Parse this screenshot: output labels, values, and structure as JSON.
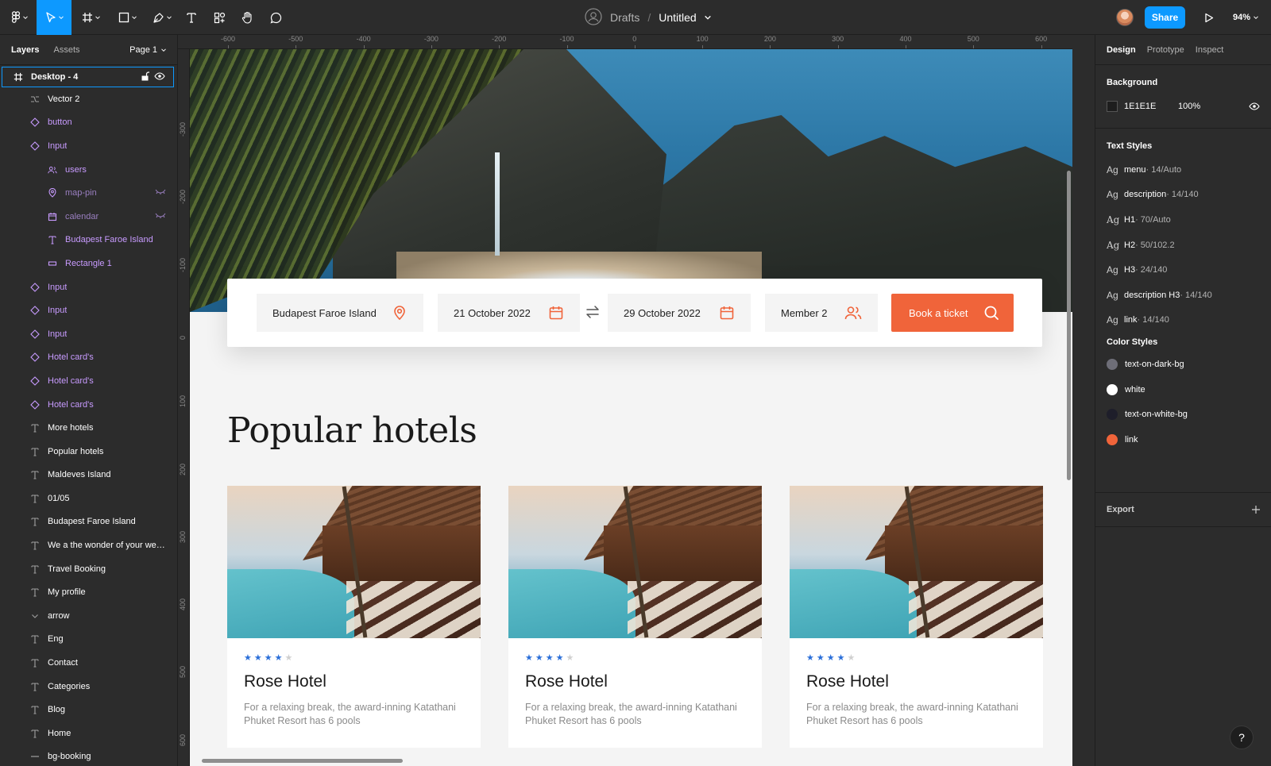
{
  "toolbar": {
    "breadcrumb_folder": "Drafts",
    "breadcrumb_separator": "/",
    "file_name": "Untitled",
    "share_label": "Share",
    "zoom_level": "94%"
  },
  "left_panel": {
    "tabs": [
      "Layers",
      "Assets"
    ],
    "page": "Page 1",
    "selected_layer": "Desktop - 4",
    "layers": [
      {
        "name": "Vector 2",
        "icon": "vector-icon",
        "kind": "plain",
        "level": "top"
      },
      {
        "name": "button",
        "icon": "component-icon",
        "kind": "comp",
        "level": "top"
      },
      {
        "name": "Input",
        "icon": "component-icon",
        "kind": "comp",
        "level": "top"
      },
      {
        "name": "users",
        "icon": "users-icon",
        "kind": "comp",
        "level": "child"
      },
      {
        "name": "map-pin",
        "icon": "map-pin-icon",
        "kind": "comp-hidden",
        "level": "child"
      },
      {
        "name": "calendar",
        "icon": "calendar-icon",
        "kind": "comp-hidden",
        "level": "child"
      },
      {
        "name": "Budapest Faroe Island",
        "icon": "text-icon",
        "kind": "comp",
        "level": "child"
      },
      {
        "name": "Rectangle 1",
        "icon": "rectangle-icon",
        "kind": "comp",
        "level": "child"
      },
      {
        "name": "Input",
        "icon": "component-icon",
        "kind": "comp",
        "level": "top"
      },
      {
        "name": "Input",
        "icon": "component-icon",
        "kind": "comp",
        "level": "top"
      },
      {
        "name": "Input",
        "icon": "component-icon",
        "kind": "comp",
        "level": "top"
      },
      {
        "name": "Hotel card's",
        "icon": "component-icon",
        "kind": "comp",
        "level": "top"
      },
      {
        "name": "Hotel card's",
        "icon": "component-icon",
        "kind": "comp",
        "level": "top"
      },
      {
        "name": "Hotel card's",
        "icon": "component-icon",
        "kind": "comp",
        "level": "top"
      },
      {
        "name": "More hotels",
        "icon": "text-icon",
        "kind": "plain",
        "level": "top"
      },
      {
        "name": "Popular hotels",
        "icon": "text-icon",
        "kind": "plain",
        "level": "top"
      },
      {
        "name": "Maldeves Island",
        "icon": "text-icon",
        "kind": "plain",
        "level": "top"
      },
      {
        "name": "01/05",
        "icon": "text-icon",
        "kind": "plain",
        "level": "top"
      },
      {
        "name": "Budapest Faroe Island",
        "icon": "text-icon",
        "kind": "plain",
        "level": "top"
      },
      {
        "name": "We a the wonder of your week...",
        "icon": "text-icon",
        "kind": "plain",
        "level": "top"
      },
      {
        "name": "Travel Booking",
        "icon": "text-icon",
        "kind": "plain",
        "level": "top"
      },
      {
        "name": "My profile",
        "icon": "text-icon",
        "kind": "plain",
        "level": "top"
      },
      {
        "name": "arrow",
        "icon": "chevron-down-icon",
        "kind": "plain",
        "level": "top"
      },
      {
        "name": "Eng",
        "icon": "text-icon",
        "kind": "plain",
        "level": "top"
      },
      {
        "name": "Contact",
        "icon": "text-icon",
        "kind": "plain",
        "level": "top"
      },
      {
        "name": "Categories",
        "icon": "text-icon",
        "kind": "plain",
        "level": "top"
      },
      {
        "name": "Blog",
        "icon": "text-icon",
        "kind": "plain",
        "level": "top"
      },
      {
        "name": "Home",
        "icon": "text-icon",
        "kind": "plain",
        "level": "top"
      },
      {
        "name": "bg-booking",
        "icon": "line-icon",
        "kind": "plain",
        "level": "top"
      }
    ]
  },
  "rulers": {
    "top": [
      "-600",
      "-500",
      "-400",
      "-300",
      "-200",
      "-100",
      "0",
      "100",
      "200",
      "300",
      "400",
      "500",
      "600"
    ],
    "left": [
      "-300",
      "-200",
      "-100",
      "0",
      "100",
      "200",
      "300",
      "400",
      "500",
      "600"
    ]
  },
  "canvas": {
    "search": {
      "location": "Budapest Faroe Island",
      "check_in": "21 October 2022",
      "check_out": "29 October 2022",
      "members": "Member 2",
      "book_label": "Book a ticket"
    },
    "section_title": "Popular hotels",
    "hotels": [
      {
        "name": "Rose Hotel",
        "rating": 4,
        "max_rating": 5,
        "description": "For a relaxing break, the award-inning Katathani Phuket Resort has 6 pools"
      },
      {
        "name": "Rose Hotel",
        "rating": 4,
        "max_rating": 5,
        "description": "For a relaxing break, the award-inning Katathani Phuket Resort has 6 pools"
      },
      {
        "name": "Rose Hotel",
        "rating": 4,
        "max_rating": 5,
        "description": "For a relaxing break, the award-inning Katathani Phuket Resort has 6 pools"
      }
    ],
    "accent_color": "#F0643A",
    "star_color": "#2B6FD9"
  },
  "right_panel": {
    "tabs": [
      "Design",
      "Prototype",
      "Inspect"
    ],
    "background": {
      "title": "Background",
      "hex": "1E1E1E",
      "opacity": "100%"
    },
    "text_styles_title": "Text Styles",
    "text_styles": [
      {
        "name": "menu",
        "meta": " · 14/Auto",
        "serif": false
      },
      {
        "name": "description",
        "meta": " · 14/140",
        "serif": false
      },
      {
        "name": "H1",
        "meta": " · 70/Auto",
        "serif": true
      },
      {
        "name": "H2",
        "meta": " · 50/102.2",
        "serif": true
      },
      {
        "name": "H3",
        "meta": " · 24/140",
        "serif": false
      },
      {
        "name": "description H3",
        "meta": " · 14/140",
        "serif": false
      },
      {
        "name": "link",
        "meta": " · 14/140",
        "serif": false
      }
    ],
    "color_styles_title": "Color Styles",
    "color_styles": [
      {
        "name": "text-on-dark-bg",
        "color": "#6E6E78"
      },
      {
        "name": "white",
        "color": "#FFFFFF"
      },
      {
        "name": "text-on-white-bg",
        "color": "#1E1E2A"
      },
      {
        "name": "link",
        "color": "#F0643A"
      }
    ],
    "export_label": "Export"
  },
  "help_label": "?"
}
